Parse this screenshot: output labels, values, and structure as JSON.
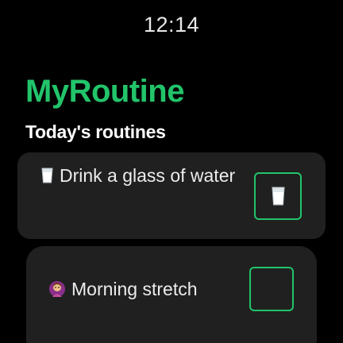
{
  "status_bar": {
    "time": "12:14"
  },
  "header": {
    "app_title": "MyRoutine",
    "section_title": "Today's routines"
  },
  "routines": [
    {
      "label": "Drink a glass of water",
      "icon": "glass-of-water-icon",
      "checkbox_icon": "glass-of-water-icon",
      "completed": false
    },
    {
      "label": "Morning stretch",
      "icon": "person-stretching-icon",
      "checkbox_icon": "",
      "completed": false
    }
  ],
  "colors": {
    "accent": "#22c46a",
    "background": "#000000",
    "card": "#202020",
    "text": "#ececec"
  }
}
